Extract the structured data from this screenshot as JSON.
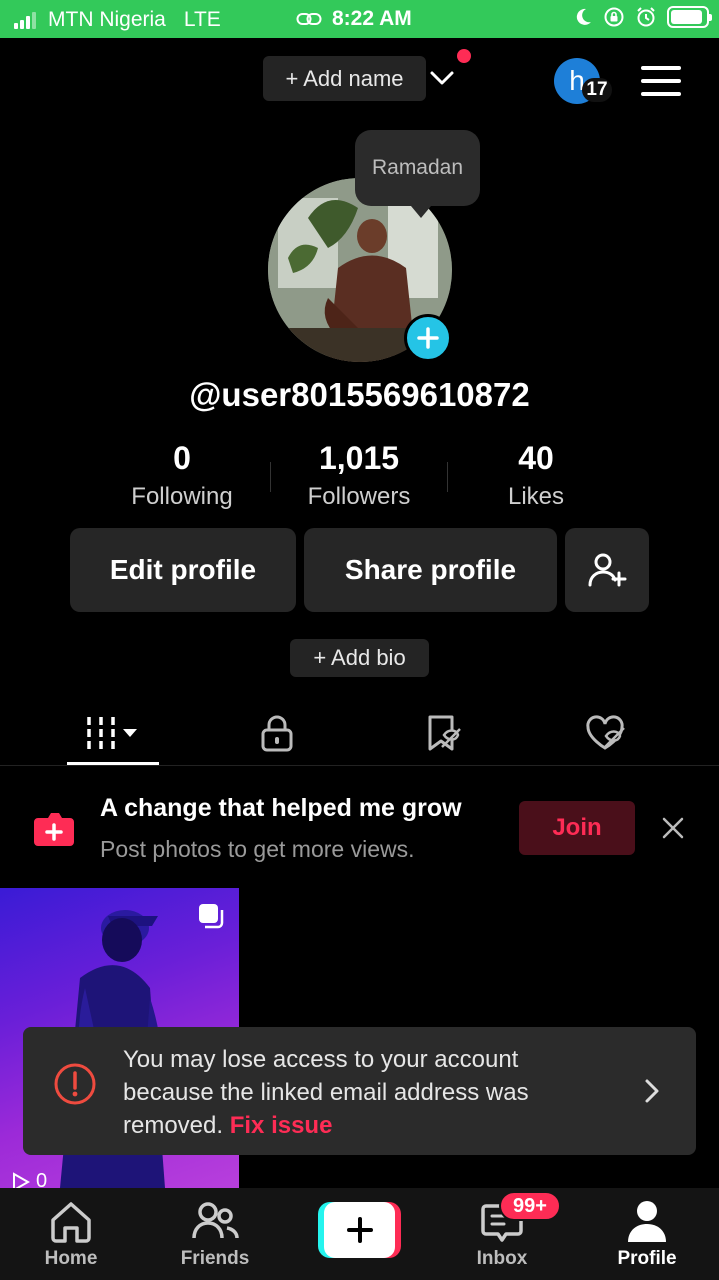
{
  "status_bar": {
    "carrier": "MTN Nigeria",
    "network": "LTE",
    "time": "8:22 AM",
    "icons": [
      "link-icon",
      "moon-icon",
      "rotation-lock-icon",
      "alarm-icon",
      "battery-icon"
    ],
    "battery_level": 0.9
  },
  "header": {
    "add_name_label": "+ Add name",
    "avatar_letter": "h",
    "avatar_badge_count": "17",
    "accent": "#fe2c55"
  },
  "profile": {
    "tooltip": "Ramadan",
    "username": "@user8015569610872",
    "stats": [
      {
        "value": "0",
        "label": "Following"
      },
      {
        "value": "1,015",
        "label": "Followers"
      },
      {
        "value": "40",
        "label": "Likes"
      }
    ],
    "edit_profile": "Edit profile",
    "share_profile": "Share profile",
    "add_bio": "+ Add bio"
  },
  "tabs": [
    "videos-grid-icon",
    "private-lock-icon",
    "saved-icon",
    "liked-icon"
  ],
  "promo": {
    "title": "A change that helped me grow",
    "subtitle": "Post photos to get more views.",
    "join": "Join"
  },
  "video": {
    "views": "0"
  },
  "toast": {
    "message": "You may lose access to your account because the linked email address was removed. ",
    "link": "Fix issue"
  },
  "bottom_nav": {
    "home": "Home",
    "friends": "Friends",
    "inbox": "Inbox",
    "inbox_badge": "99+",
    "profile": "Profile"
  },
  "colors": {
    "status_bar": "#33c95a",
    "accent_red": "#fe2c55",
    "accent_cyan": "#25c4e6"
  }
}
